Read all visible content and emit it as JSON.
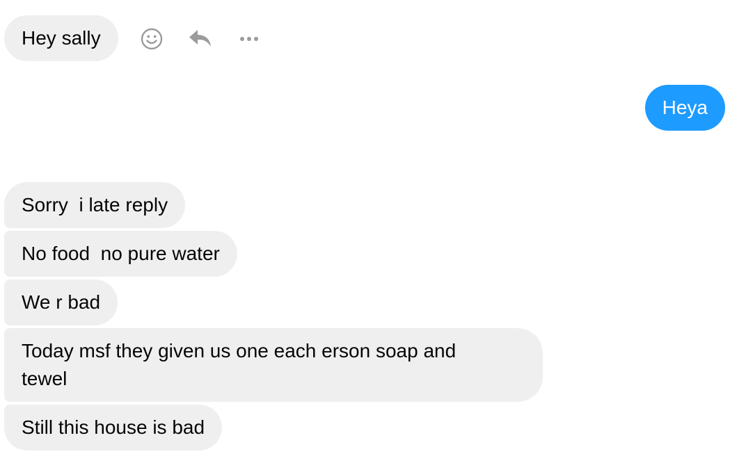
{
  "messages": [
    {
      "direction": "incoming",
      "text": "Hey sally"
    },
    {
      "direction": "outgoing",
      "text": "Heya"
    },
    {
      "direction": "incoming",
      "text": "Sorry  i late reply"
    },
    {
      "direction": "incoming",
      "text": "No food  no pure water"
    },
    {
      "direction": "incoming",
      "text": "We r bad"
    },
    {
      "direction": "incoming",
      "text": "Today msf they given us one each erson soap and\ntewel"
    },
    {
      "direction": "incoming",
      "text": "Still this house is bad"
    }
  ],
  "message_actions": {
    "icons": [
      "smiley-icon",
      "reply-icon",
      "more-icon"
    ]
  },
  "colors": {
    "incoming_bubble": "#efefef",
    "outgoing_bubble": "#1e9bff",
    "incoming_text": "#050505",
    "outgoing_text": "#ffffff",
    "icon": "#9b9b9b"
  }
}
